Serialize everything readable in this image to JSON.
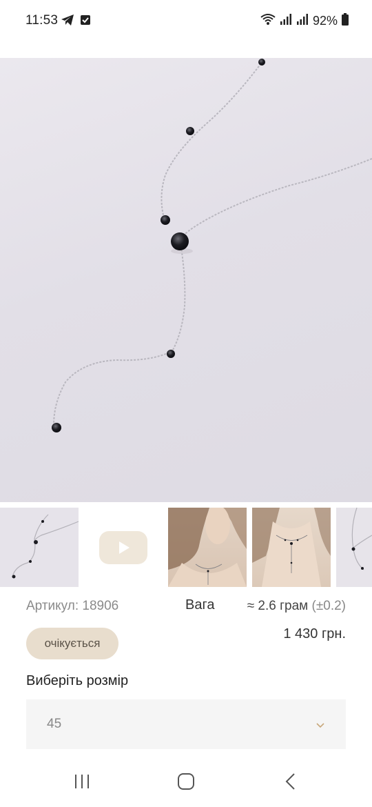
{
  "status_bar": {
    "time": "11:53",
    "battery": "92%",
    "icons": [
      "telegram-icon",
      "checkbox-notification-icon",
      "wifi-icon",
      "signal-icon",
      "signal-icon",
      "battery-icon"
    ]
  },
  "hero": {
    "icon": "necklace-product-photo"
  },
  "thumbnails": [
    {
      "icon": "necklace-thumbnail"
    },
    {
      "icon": "play-video-icon"
    },
    {
      "icon": "model-photo-thumbnail"
    },
    {
      "icon": "model-closeup-thumbnail"
    },
    {
      "icon": "necklace-thumbnail"
    }
  ],
  "product": {
    "article": "Артикул: 18906",
    "weight_label": "Вага",
    "weight_value": "≈ 2.6 грам",
    "weight_tolerance": "(±0.2)",
    "status_badge": "очікується",
    "price": "1 430 грн."
  },
  "size": {
    "title": "Виберіть розмір",
    "selected": "45"
  },
  "colors": {
    "badge_bg": "#e8ddcd",
    "select_bg": "#f5f5f5",
    "accent_gold": "#c8a77a"
  }
}
